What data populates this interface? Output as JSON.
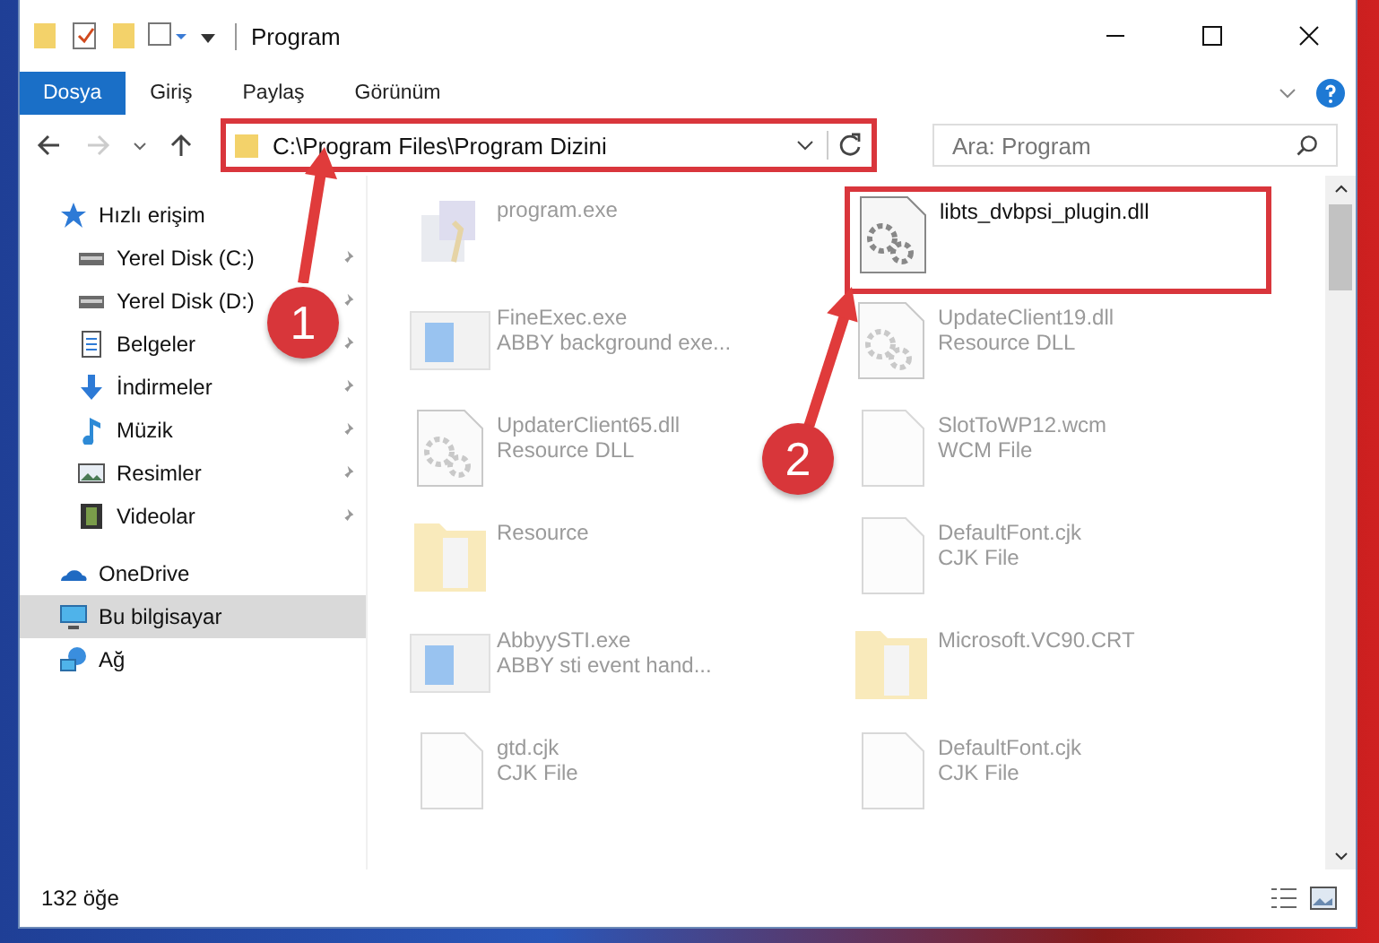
{
  "window": {
    "title": "Program"
  },
  "ribbon_tabs": [
    {
      "label": "Dosya",
      "selected": true
    },
    {
      "label": "Giriş",
      "selected": false
    },
    {
      "label": "Paylaş",
      "selected": false
    },
    {
      "label": "Görünüm",
      "selected": false
    }
  ],
  "address": {
    "path": "C:\\Program Files\\Program Dizini",
    "highlighted": true
  },
  "search": {
    "placeholder": "Ara: Program"
  },
  "sidebar": {
    "items": [
      {
        "label": "Hızlı erişim",
        "kind": "star",
        "selected": false,
        "children": [
          {
            "label": "Yerel Disk (C:)",
            "kind": "drive",
            "pinned": true,
            "selected": false
          },
          {
            "label": "Yerel Disk (D:)",
            "kind": "drive",
            "pinned": true,
            "selected": false
          },
          {
            "label": "Belgeler",
            "kind": "docs",
            "pinned": true,
            "selected": false
          },
          {
            "label": "İndirmeler",
            "kind": "download",
            "pinned": true,
            "selected": false
          },
          {
            "label": "Müzik",
            "kind": "music",
            "pinned": true,
            "selected": false
          },
          {
            "label": "Resimler",
            "kind": "pictures",
            "pinned": true,
            "selected": false
          },
          {
            "label": "Videolar",
            "kind": "video",
            "pinned": true,
            "selected": false
          }
        ]
      },
      {
        "label": "OneDrive",
        "kind": "cloud",
        "selected": false
      },
      {
        "label": "Bu bilgisayar",
        "kind": "pc",
        "selected": true
      },
      {
        "label": "Ağ",
        "kind": "network",
        "selected": false
      }
    ]
  },
  "files": [
    {
      "name": "program.exe",
      "kind": "exe",
      "faded": true,
      "highlighted": false
    },
    {
      "name": "libts_dvbpsi_plugin.dll",
      "kind": "dll",
      "faded": false,
      "highlighted": true
    },
    {
      "name": "FineExec.exe",
      "type": "ABBY background exe...",
      "kind": "app",
      "faded": true,
      "highlighted": false
    },
    {
      "name": "UpdateClient19.dll",
      "type": "Resource DLL",
      "kind": "dll",
      "faded": true,
      "highlighted": false
    },
    {
      "name": "UpdaterClient65.dll",
      "type": "Resource DLL",
      "kind": "dll",
      "faded": true,
      "highlighted": false
    },
    {
      "name": "SlotToWP12.wcm",
      "type": "WCM File",
      "kind": "doc",
      "faded": true,
      "highlighted": false
    },
    {
      "name": "Resource",
      "kind": "folder",
      "faded": true,
      "highlighted": false
    },
    {
      "name": "DefaultFont.cjk",
      "type": "CJK File",
      "kind": "doc",
      "faded": true,
      "highlighted": false
    },
    {
      "name": "AbbyySTI.exe",
      "type": "ABBY sti event hand...",
      "kind": "app",
      "faded": true,
      "highlighted": false
    },
    {
      "name": "Microsoft.VC90.CRT",
      "kind": "folder",
      "faded": true,
      "highlighted": false
    },
    {
      "name": "gtd.cjk",
      "type": "CJK File",
      "kind": "doc",
      "faded": true,
      "highlighted": false
    },
    {
      "name": "DefaultFont.cjk",
      "type": "CJK File",
      "kind": "doc",
      "faded": true,
      "highlighted": false
    }
  ],
  "status_bar": {
    "item_count": "132 öğe"
  },
  "annotations": [
    {
      "label": "1"
    },
    {
      "label": "2"
    }
  ]
}
